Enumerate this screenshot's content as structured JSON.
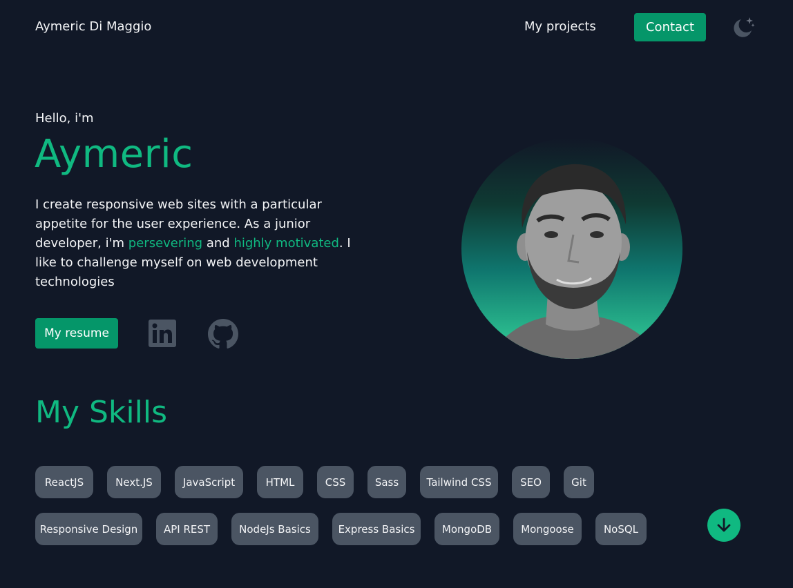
{
  "header": {
    "brand": "Aymeric Di Maggio",
    "nav_projects": "My projects",
    "contact_label": "Contact",
    "theme_icon": "moon-stars-icon"
  },
  "hero": {
    "greeting": "Hello, i'm",
    "name": "Aymeric",
    "desc_part1": "I create responsive web sites with a particular appetite for the user experience. As a junior developer, i'm ",
    "desc_accent1": "persevering",
    "desc_part2": " and ",
    "desc_accent2": "highly motivated",
    "desc_part3": ". I like to challenge myself on web development technologies",
    "resume_label": "My resume",
    "social_icons": [
      "linkedin-icon",
      "github-icon"
    ],
    "avatar_icon": "profile-photo"
  },
  "skills": {
    "title": "My Skills",
    "row1": [
      "ReactJS",
      "Next.JS",
      "JavaScript",
      "HTML",
      "CSS",
      "Sass",
      "Tailwind CSS",
      "SEO",
      "Git"
    ],
    "row2": [
      "Responsive Design",
      "API REST",
      "NodeJs Basics",
      "Express Basics",
      "MongoDB",
      "Mongoose",
      "NoSQL"
    ],
    "scroll_icon": "arrow-down-icon"
  },
  "colors": {
    "background": "#111827",
    "accent": "#10b981",
    "button": "#059669",
    "chip": "#4b5563",
    "icon_muted": "#4b5563"
  }
}
